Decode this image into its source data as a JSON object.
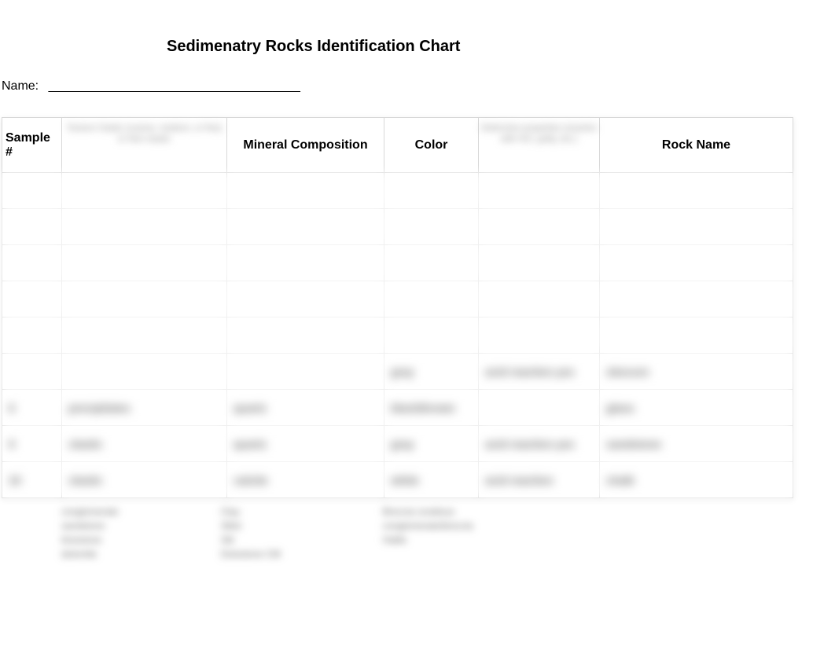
{
  "title": "Sedimenatry Rocks Identification Chart",
  "name_label": "Name:",
  "name_blank": "____________________________________",
  "headers": {
    "sample": "Sample #",
    "texture_blur": "Texture\nClastic (coarse, medium, or fine)\nor\nNon-clastic",
    "mineral": "Mineral Composition",
    "color": "Color",
    "distinct_blur": "Distinctive\nproperties\n(reaction with\nHCl, gritty, etc.)",
    "rockname": "Rock Name"
  },
  "rows": [
    {
      "sample": "",
      "texture": "",
      "mineral": "",
      "color": "",
      "distinct": "",
      "rockname": ""
    },
    {
      "sample": "",
      "texture": "",
      "mineral": "",
      "color": "",
      "distinct": "",
      "rockname": ""
    },
    {
      "sample": "",
      "texture": "",
      "mineral": "",
      "color": "",
      "distinct": "",
      "rockname": ""
    },
    {
      "sample": "",
      "texture": "",
      "mineral": "",
      "color": "",
      "distinct": "",
      "rockname": ""
    },
    {
      "sample": "",
      "texture": "",
      "mineral": "",
      "color": "",
      "distinct": "",
      "rockname": ""
    },
    {
      "sample": "",
      "texture": "",
      "mineral": "",
      "color": "gray",
      "distinct": "acid reaction yes",
      "rockname": "obscure"
    },
    {
      "sample": "6",
      "texture": "precipitates",
      "mineral": "quartz",
      "color": "black/brown",
      "distinct": "",
      "rockname": "glass"
    },
    {
      "sample": "9",
      "texture": "clastic",
      "mineral": "quartz",
      "color": "gray",
      "distinct": "acid reaction yes",
      "rockname": "sandstone"
    },
    {
      "sample": "10",
      "texture": "clastic",
      "mineral": "calcite",
      "color": "white",
      "distinct": "acid reaction",
      "rockname": "chalk"
    }
  ],
  "footer": {
    "col1": [
      "conglomerate",
      "sandstone",
      "limestone",
      "dolomite"
    ],
    "col2": [
      "Clay",
      "Siltst",
      "Silt",
      "Dolostone CM"
    ],
    "col3": [
      "Breccia coralious",
      "conglomerate/breccia",
      "Halite"
    ]
  }
}
